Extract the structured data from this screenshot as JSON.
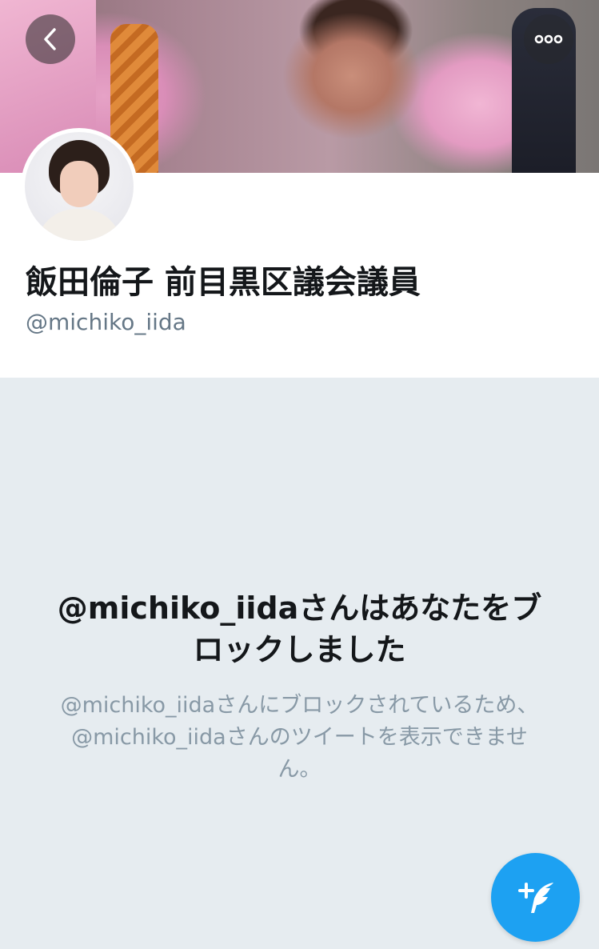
{
  "profile": {
    "display_name": "飯田倫子 前目黒区議会議員",
    "handle": "@michiko_iida"
  },
  "blocked_notice": {
    "title": "@michiko_iidaさんはあなたをブロックしました",
    "description": "@michiko_iidaさんにブロックされているため、@michiko_iidaさんのツイートを表示できません。"
  },
  "icons": {
    "back": "chevron-left-icon",
    "more": "more-dots-icon",
    "compose": "compose-tweet-icon"
  },
  "colors": {
    "accent": "#1da1f2",
    "background": "#e6ecf0",
    "secondary_text": "#657786"
  }
}
